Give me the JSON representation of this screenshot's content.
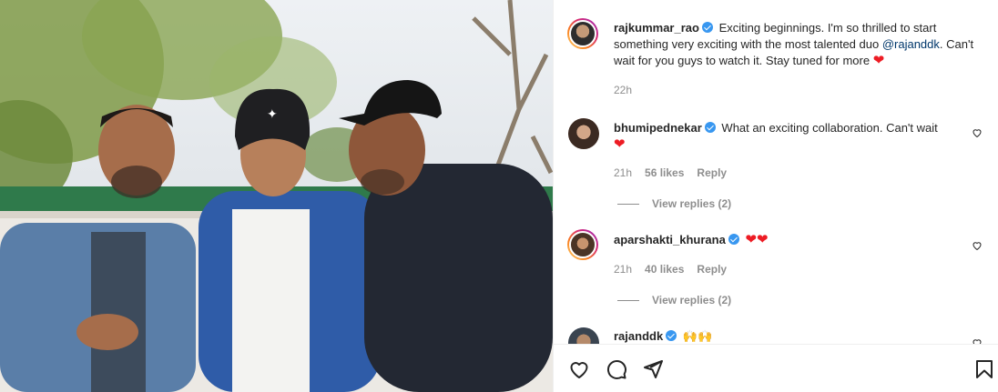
{
  "post": {
    "author": "rajkummar_rao",
    "caption_text": "Exciting beginnings. I'm so thrilled to start something very exciting with the most talented duo ",
    "caption_mention": "@rajanddk",
    "caption_end": ". Can't wait for you guys to watch it. Stay tuned for more ",
    "time": "22h"
  },
  "comments": [
    {
      "username": "bhumipednekar",
      "text": "What an exciting collaboration. Can't wait",
      "emoji": "❤",
      "time": "21h",
      "likes": "56 likes",
      "reply": "Reply",
      "view_replies": "View replies (2)"
    },
    {
      "username": "aparshakti_khurana",
      "text": "",
      "emoji": "❤❤",
      "time": "21h",
      "likes": "40 likes",
      "reply": "Reply",
      "view_replies": "View replies (2)"
    },
    {
      "username": "rajanddk",
      "text": "",
      "emoji": "🙌🙌"
    }
  ],
  "icons": {
    "like": "heart-outline-icon",
    "comment": "speech-bubble-icon",
    "share": "paper-plane-icon",
    "save": "bookmark-icon",
    "verified": "verified-badge-icon"
  },
  "colors": {
    "verified": "#3897f0",
    "heart": "#ed1c24",
    "meta": "#8e8e8e",
    "mention": "#00376b"
  }
}
